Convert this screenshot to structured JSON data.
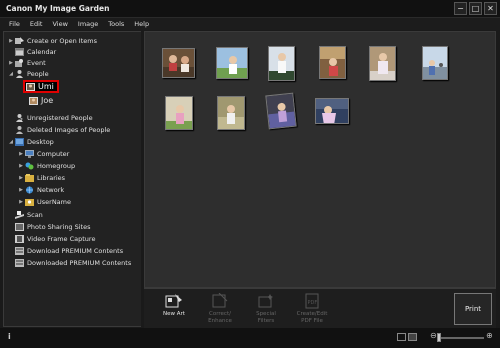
{
  "window": {
    "title": "Canon My Image Garden"
  },
  "menu": [
    "File",
    "Edit",
    "View",
    "Image",
    "Tools",
    "Help"
  ],
  "sidebar": {
    "items": [
      {
        "label": "Create or Open Items"
      },
      {
        "label": "Calendar"
      },
      {
        "label": "Event"
      },
      {
        "label": "People"
      },
      {
        "label": "Umi"
      },
      {
        "label": "Joe"
      },
      {
        "label": "Unregistered People"
      },
      {
        "label": "Deleted Images of People"
      },
      {
        "label": "Desktop"
      },
      {
        "label": "Computer"
      },
      {
        "label": "Homegroup"
      },
      {
        "label": "Libraries"
      },
      {
        "label": "Network"
      },
      {
        "label": "UserName"
      },
      {
        "label": "Scan"
      },
      {
        "label": "Photo Sharing Sites"
      },
      {
        "label": "Video Frame Capture"
      },
      {
        "label": "Download PREMIUM Contents"
      },
      {
        "label": "Downloaded PREMIUM Contents"
      }
    ]
  },
  "toolbar": {
    "new_art": "New Art",
    "correct_enhance_1": "Correct/",
    "correct_enhance_2": "Enhance",
    "special_filters_1": "Special",
    "special_filters_2": "Filters",
    "create_pdf_1": "Create/Edit",
    "create_pdf_2": "PDF File",
    "print": "Print"
  },
  "status": {
    "info": "i"
  },
  "colors": {
    "selection_outline": "#e00000",
    "background": "#2e2e2e"
  }
}
